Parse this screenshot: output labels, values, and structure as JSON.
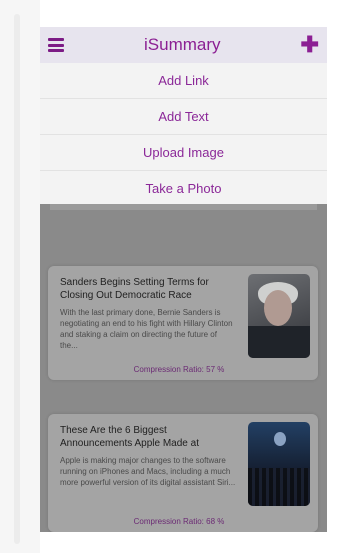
{
  "navbar": {
    "title": "iSummary"
  },
  "dropdown": {
    "items": [
      {
        "label": "Add Link"
      },
      {
        "label": "Add Text"
      },
      {
        "label": "Upload Image"
      },
      {
        "label": "Take a Photo"
      }
    ]
  },
  "articles": [
    {
      "title": "Sanders Begins Setting Terms for Closing Out Democratic Race",
      "summary": "With the last primary done, Bernie Sanders is negotiating an end to his fight with Hillary Clinton and staking a claim on directing the future of the...",
      "compression_label": "Compression Ratio:",
      "compression_value": "57 %"
    },
    {
      "title": "These Are the 6 Biggest Announcements Apple Made at",
      "summary": "Apple is making major changes to the software running on iPhones and Macs, including a much more powerful version of its digital assistant Siri...",
      "compression_label": "Compression Ratio:",
      "compression_value": "68 %"
    }
  ],
  "colors": {
    "accent": "#8b1f93",
    "navbar_bg": "#e7e4ee",
    "dropdown_bg": "#f3f3f3",
    "overlay_bg": "#8a8a8a",
    "card_bg": "#a4a4a4"
  }
}
